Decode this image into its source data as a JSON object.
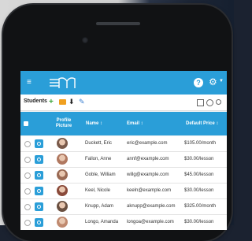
{
  "app": {
    "toolbar_title": "Students",
    "help_label": "?"
  },
  "table": {
    "columns": {
      "picture": "Profile Picture",
      "name": "Name ↕",
      "email": "Email ↕",
      "price": "Default Price ↕"
    },
    "rows": [
      {
        "name": "Duckett, Eric",
        "email": "eric@example.com",
        "price": "$105.00/month",
        "avatar_color": "#7a5a4a"
      },
      {
        "name": "Fallon, Anne",
        "email": "annf@example.com",
        "price": "$30.00/lesson",
        "avatar_color": "#b07860"
      },
      {
        "name": "Goble, William",
        "email": "willg@example.com",
        "price": "$45.00/lesson",
        "avatar_color": "#9a6a54"
      },
      {
        "name": "Keel, Nicole",
        "email": "keeln@example.com",
        "price": "$30.00/lesson",
        "avatar_color": "#8a4a3a"
      },
      {
        "name": "Knupp, Adam",
        "email": "aknupp@example.com",
        "price": "$325.00/month",
        "avatar_color": "#6a5040"
      },
      {
        "name": "Longo, Amanda",
        "email": "longoa@example.com",
        "price": "$30.00/lesson",
        "avatar_color": "#c08a70"
      }
    ]
  },
  "colors": {
    "accent": "#2a9ed8",
    "add_icon": "#3aa53a",
    "email_icon": "#f0a020"
  },
  "icons": [
    "hamburger-icon",
    "logo-icon",
    "help-icon",
    "gear-icon",
    "plus-icon",
    "email-icon",
    "download-icon",
    "wrench-icon",
    "columns-icon",
    "ban-icon",
    "search-icon",
    "zoom-icon"
  ]
}
